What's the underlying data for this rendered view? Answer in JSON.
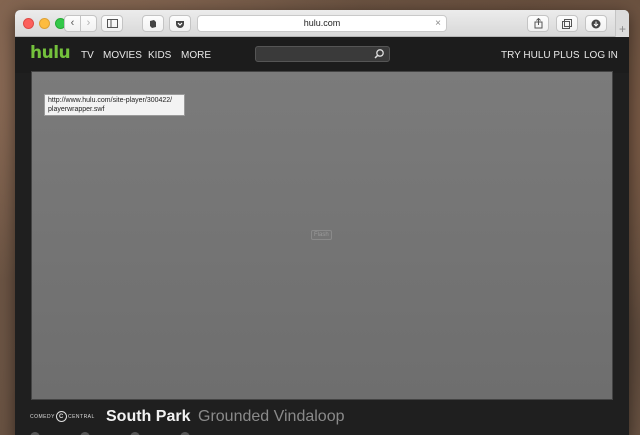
{
  "browser": {
    "url": "hulu.com",
    "nav_back": "‹",
    "nav_forward": "›",
    "clear": "×",
    "new_tab": "+"
  },
  "hulu": {
    "logo": "hulu",
    "nav": [
      "TV",
      "MOVIES",
      "KIDS",
      "MORE"
    ],
    "search_placeholder": "",
    "right_links": [
      "TRY HULU PLUS",
      "LOG IN"
    ],
    "brand_color": "#74c13c"
  },
  "player": {
    "tooltip": "http://www.hulu.com/site-player/300422/\nplayerwrapper.swf",
    "flash_label": "Flash"
  },
  "show": {
    "network_left": "COMEDY",
    "network_mark": "C",
    "network_right": "CENTRAL",
    "title": "South Park",
    "episode": "Grounded Vindaloop"
  }
}
